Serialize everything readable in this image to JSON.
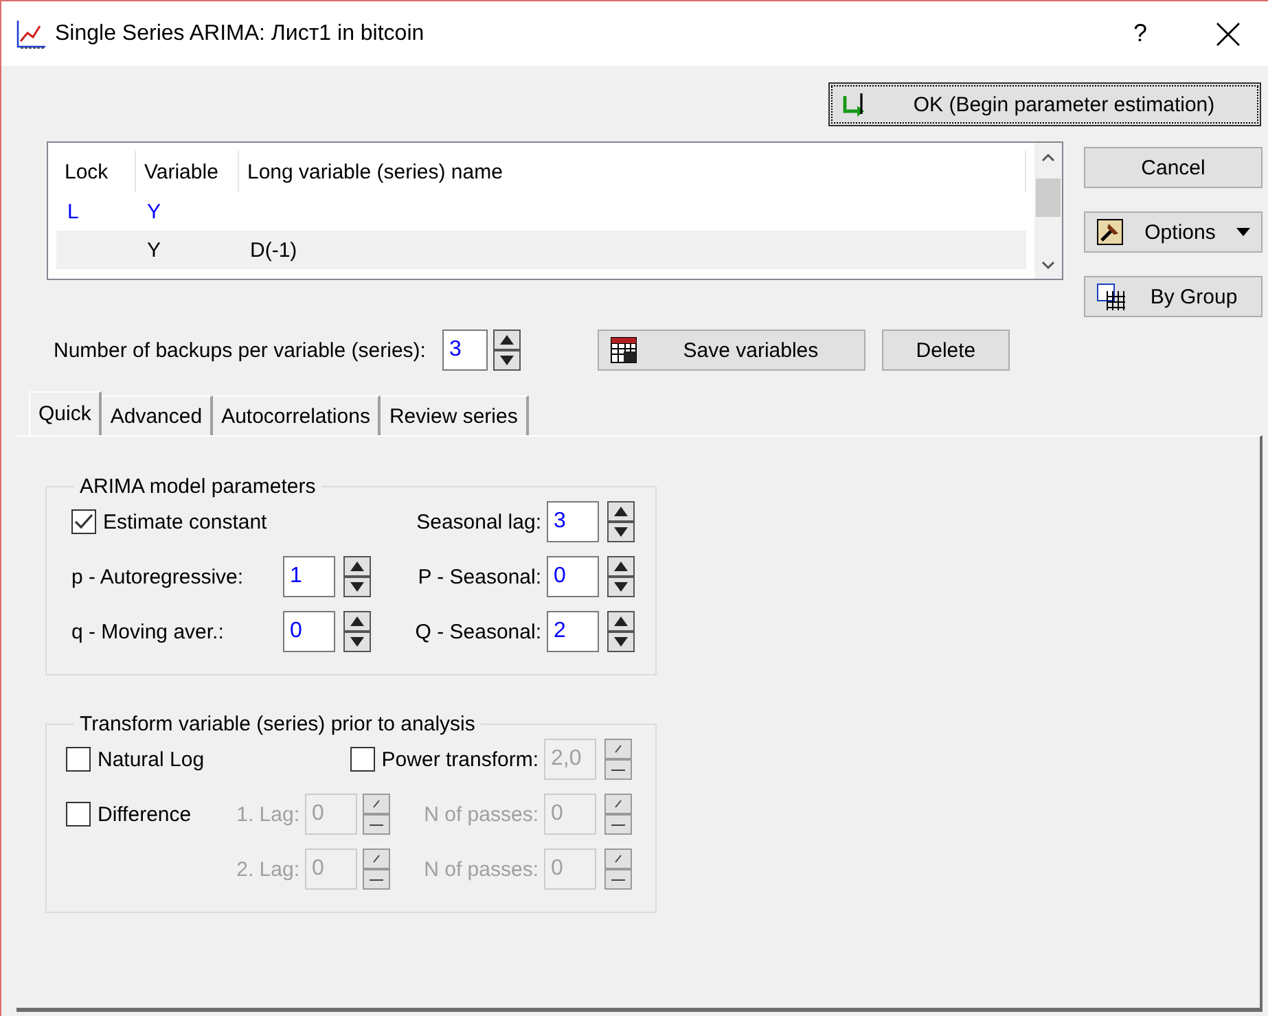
{
  "window": {
    "title": "Single Series ARIMA: Лист1 in bitcoin",
    "help": "?"
  },
  "buttons": {
    "ok": "OK (Begin parameter estimation)",
    "cancel": "Cancel",
    "options": "Options",
    "by_group": "By Group",
    "save_variables": "Save variables",
    "delete": "Delete"
  },
  "table": {
    "columns": [
      "Lock",
      "Variable",
      "Long variable (series) name"
    ],
    "rows": [
      {
        "lock": "L",
        "variable": "Y",
        "locked": true,
        "selected": false
      },
      {
        "variable": "Y",
        "long_name": "D(-1)",
        "locked": false,
        "selected": true
      }
    ]
  },
  "backups": {
    "label": "Number of backups per variable (series):",
    "value": "3"
  },
  "tabs": [
    {
      "label": "Quick",
      "selected": true
    },
    {
      "label": "Advanced",
      "selected": false
    },
    {
      "label": "Autocorrelations",
      "selected": false
    },
    {
      "label": "Review series",
      "selected": false
    }
  ],
  "arima": {
    "title": "ARIMA model parameters",
    "estimate_constant": {
      "label": "Estimate constant",
      "checked": true
    },
    "left_fields": [
      {
        "label": "p - Autoregressive:",
        "value": "1"
      },
      {
        "label": "q - Moving aver.:",
        "value": "0"
      }
    ],
    "right_fields": [
      {
        "label": "Seasonal lag:",
        "value": "3"
      },
      {
        "label": "P - Seasonal:",
        "value": "0"
      },
      {
        "label": "Q - Seasonal:",
        "value": "2"
      }
    ]
  },
  "transform": {
    "title": "Transform variable (series) prior to analysis",
    "natural_log": {
      "label": "Natural Log",
      "checked": false
    },
    "power_transform": {
      "label": "Power transform:",
      "checked": false,
      "value": "2,0",
      "disabled": true
    },
    "difference": {
      "label": "Difference",
      "checked": false
    },
    "lags": [
      {
        "lag_label": "1. Lag:",
        "lag_value": "0",
        "passes_label": "N of passes:",
        "passes_value": "0",
        "disabled": true
      },
      {
        "lag_label": "2. Lag:",
        "lag_value": "0",
        "passes_label": "N of passes:",
        "passes_value": "0",
        "disabled": true
      }
    ]
  }
}
